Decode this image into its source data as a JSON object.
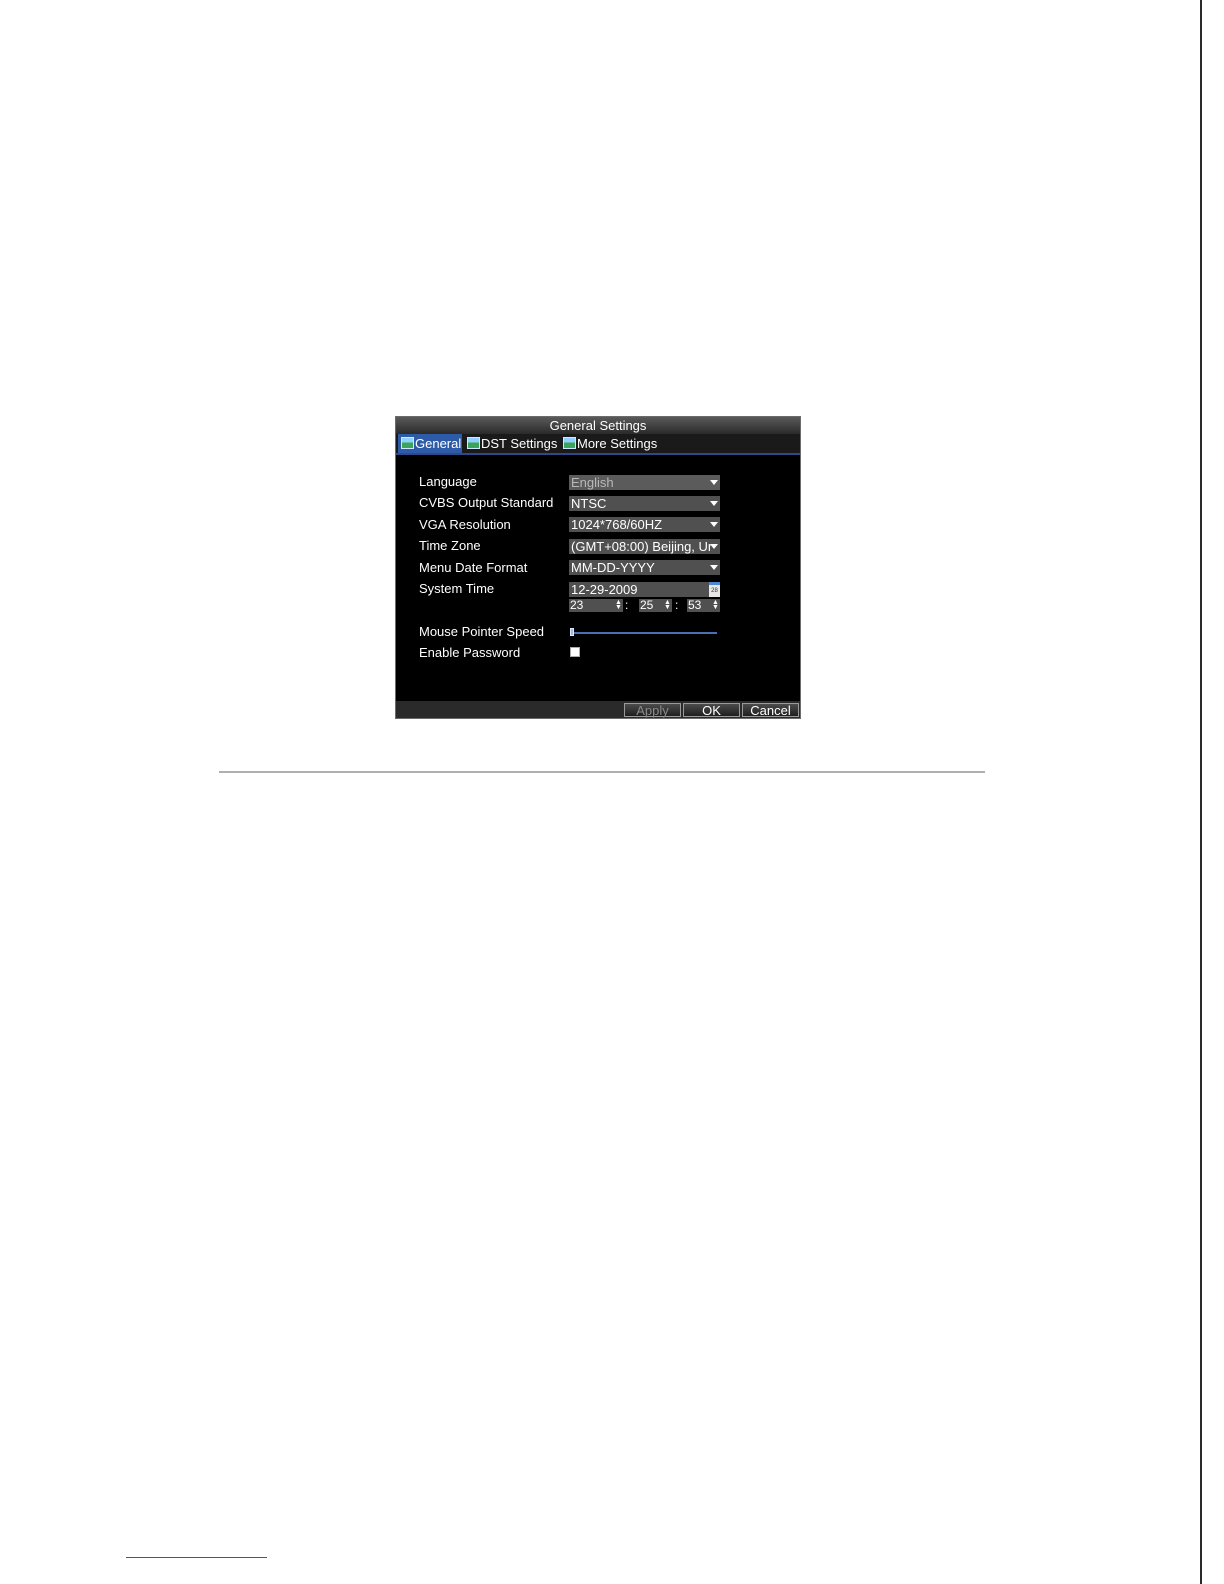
{
  "dialog": {
    "title": "General Settings",
    "tabs": [
      {
        "label": "General",
        "active": true
      },
      {
        "label": "DST Settings",
        "active": false
      },
      {
        "label": "More Settings",
        "active": false
      }
    ],
    "fields": {
      "language": {
        "label": "Language",
        "value": "English",
        "enabled": false
      },
      "cvbs": {
        "label": "CVBS Output Standard",
        "value": "NTSC"
      },
      "vga": {
        "label": "VGA Resolution",
        "value": "1024*768/60HZ"
      },
      "timezone": {
        "label": "Time Zone",
        "value": "(GMT+08:00) Beijing, Ur"
      },
      "date_format": {
        "label": "Menu Date Format",
        "value": "MM-DD-YYYY"
      },
      "system_time": {
        "label": "System Time",
        "date": "12-29-2009",
        "hour": "23",
        "minute": "25",
        "second": "53",
        "separator": ":"
      },
      "mouse_speed": {
        "label": "Mouse Pointer Speed",
        "level": 0.0
      },
      "enable_password": {
        "label": "Enable Password",
        "checked": false
      }
    },
    "buttons": {
      "apply": "Apply",
      "ok": "OK",
      "cancel": "Cancel"
    }
  },
  "colors": {
    "dialog_bg": "#000000",
    "tab_active": "#2d5ba8",
    "field_bg": "#505050",
    "slider": "#4a6fb3"
  }
}
